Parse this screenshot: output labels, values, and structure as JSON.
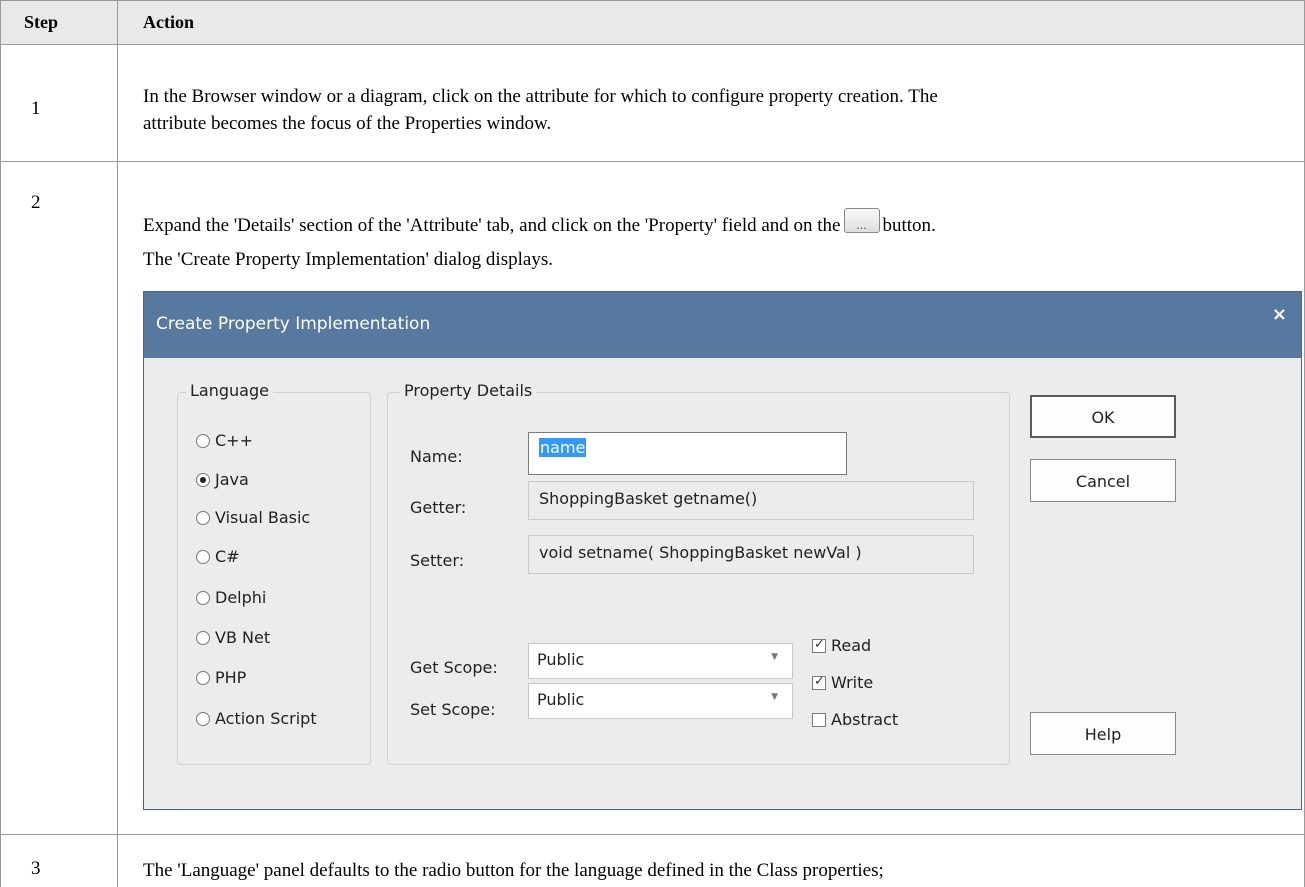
{
  "table": {
    "headers": {
      "step": "Step",
      "action": "Action"
    },
    "rows": [
      {
        "step": "1",
        "lines": [
          "In the Browser window or a diagram, click on the attribute for which to configure property creation. The",
          "attribute becomes the focus of the Properties window."
        ]
      },
      {
        "step": "2",
        "line1_before": "Expand the 'Details' section of the 'Attribute' tab, and click on the 'Property' field and on the",
        "line1_after": "button.",
        "line2": "The 'Create Property Implementation' dialog displays.",
        "button_glyph": "..."
      },
      {
        "step": "3",
        "line": "The 'Language' panel defaults to the radio button for the language defined in the Class properties;"
      }
    ]
  },
  "dialog": {
    "title": "Create Property Implementation",
    "close_glyph": "×",
    "language_group": {
      "legend": "Language",
      "options": [
        "C++",
        "Java",
        "Visual Basic",
        "C#",
        "Delphi",
        "VB Net",
        "PHP",
        "Action Script"
      ],
      "selected": "Java"
    },
    "details_group": {
      "legend": "Property Details",
      "name_label": "Name:",
      "name_value": "name",
      "getter_label": "Getter:",
      "getter_value": "ShoppingBasket getname()",
      "setter_label": "Setter:",
      "setter_value": "void setname( ShoppingBasket newVal )",
      "get_scope_label": "Get Scope:",
      "get_scope_value": "Public",
      "set_scope_label": "Set Scope:",
      "set_scope_value": "Public",
      "read_label": "Read",
      "read_checked": true,
      "write_label": "Write",
      "write_checked": true,
      "abstract_label": "Abstract",
      "abstract_checked": false
    },
    "buttons": {
      "ok": "OK",
      "cancel": "Cancel",
      "help": "Help"
    }
  }
}
